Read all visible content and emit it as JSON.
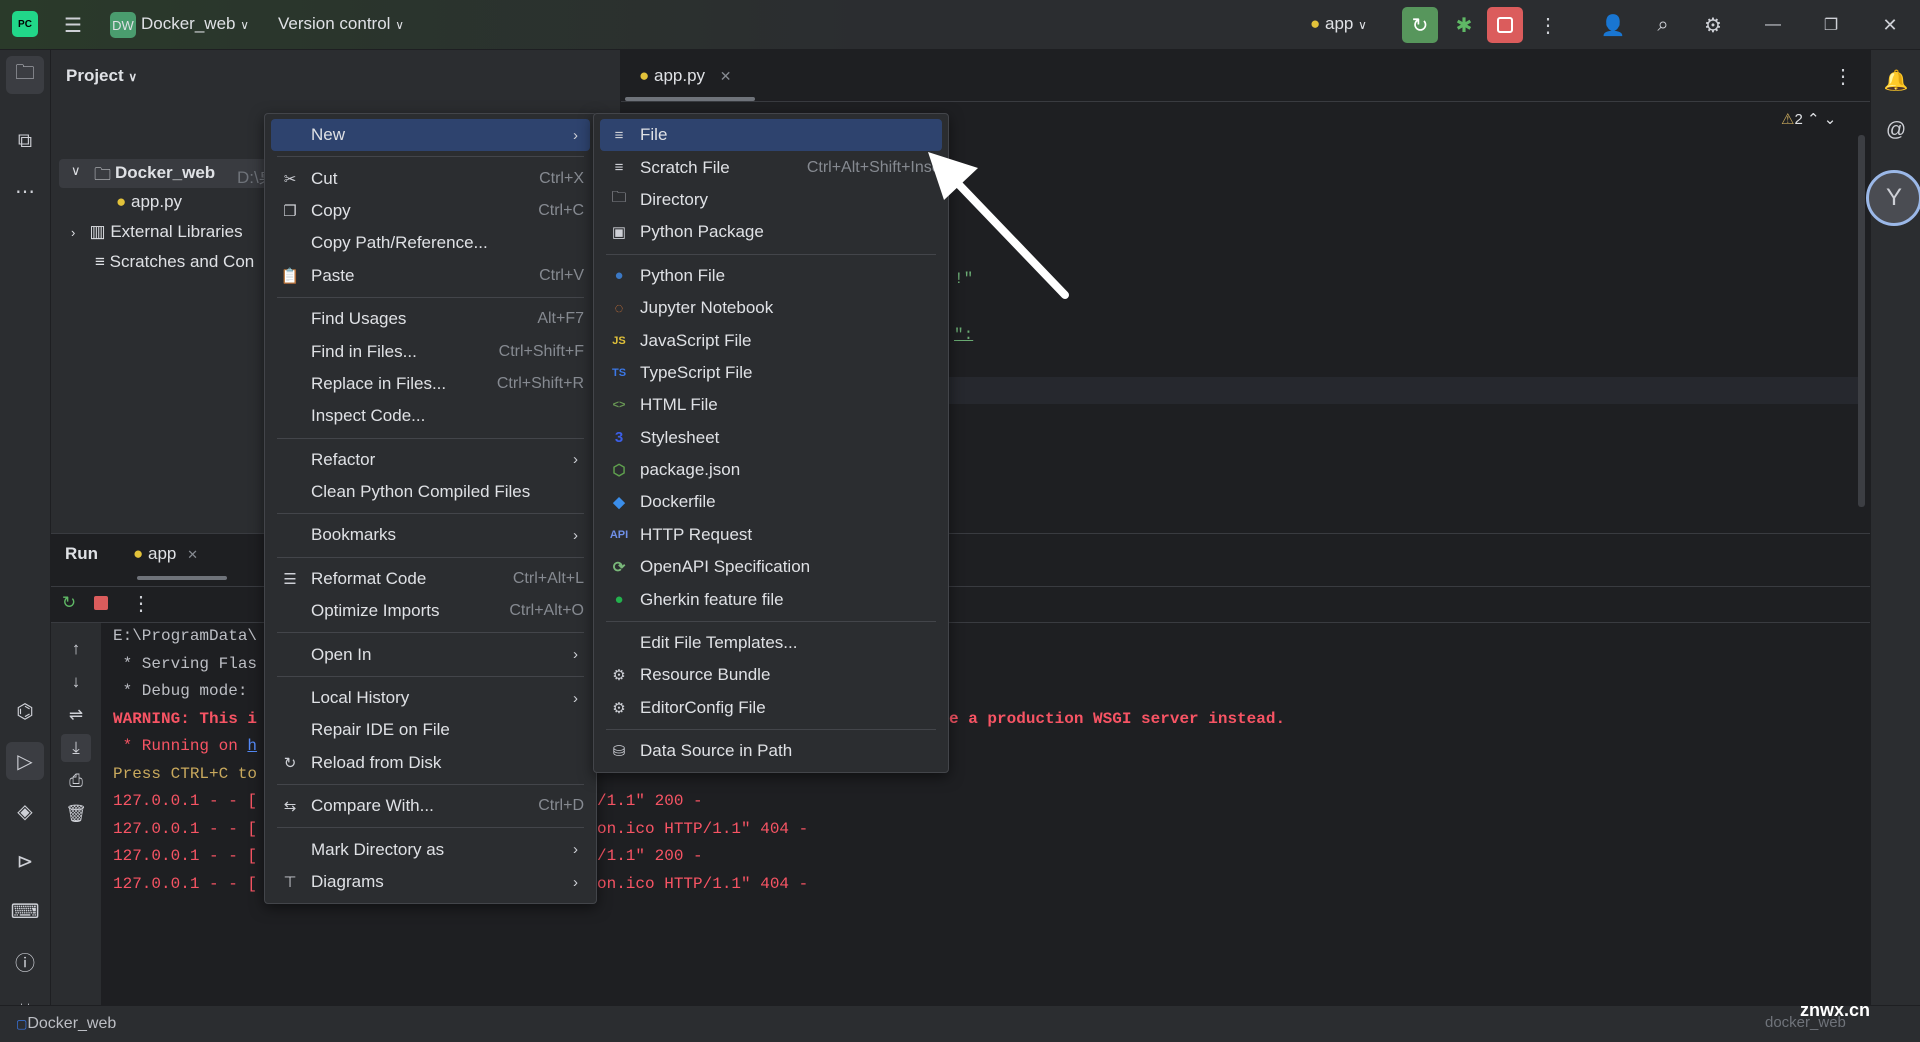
{
  "titlebar": {
    "project_badge": "DW",
    "project_name": "Docker_web",
    "vcs": "Version control",
    "run_config": "app"
  },
  "project_panel": {
    "title": "Project",
    "tree": [
      {
        "label": "Docker_web",
        "path": "D:\\桌"
      },
      {
        "label": "app.py"
      },
      {
        "label": "External Libraries"
      },
      {
        "label": "Scratches and Con"
      }
    ]
  },
  "editor": {
    "tab": "app.py",
    "warnings": "2",
    "fragments": [
      "!\"",
      "\":"
    ]
  },
  "run_panel": {
    "title": "Run",
    "tab": "app",
    "lines": [
      {
        "left": "E:\\ProgramData\\",
        "right": "",
        "color": "#bcbec4"
      },
      {
        "left": " * Serving Flas",
        "right": "",
        "color": "#bcbec4"
      },
      {
        "left": " * Debug mode:",
        "right": "",
        "color": "#bcbec4"
      },
      {
        "left": "WARNING: This i",
        "right": "e a production WSGI server instead.",
        "color": "#f75464",
        "bold": true
      },
      {
        "left": " * Running on ",
        "link": "h",
        "right": "",
        "color": "#f75464"
      },
      {
        "left": "Press CTRL+C to",
        "right": "",
        "color": "#c9a95d"
      },
      {
        "left": "127.0.0.1 - - [",
        "right": "/1.1\" 200 -",
        "color": "#f75464"
      },
      {
        "left": "127.0.0.1 - - [",
        "right": "on.ico HTTP/1.1\" 404 -",
        "color": "#f75464"
      },
      {
        "left": "127.0.0.1 - - [",
        "right": "/1.1\" 200 -",
        "color": "#f75464"
      },
      {
        "left": "127.0.0.1 - - [",
        "right": "on.ico HTTP/1.1\" 404 -",
        "color": "#f75464"
      }
    ]
  },
  "context_menu": [
    {
      "label": "New",
      "sub": true,
      "selected": true
    },
    {
      "sep": true
    },
    {
      "label": "Cut",
      "shortcut": "Ctrl+X",
      "icon": "✂"
    },
    {
      "label": "Copy",
      "shortcut": "Ctrl+C",
      "icon": "❐"
    },
    {
      "label": "Copy Path/Reference..."
    },
    {
      "label": "Paste",
      "shortcut": "Ctrl+V",
      "icon": "📋"
    },
    {
      "sep": true
    },
    {
      "label": "Find Usages",
      "shortcut": "Alt+F7"
    },
    {
      "label": "Find in Files...",
      "shortcut": "Ctrl+Shift+F"
    },
    {
      "label": "Replace in Files...",
      "shortcut": "Ctrl+Shift+R"
    },
    {
      "label": "Inspect Code..."
    },
    {
      "sep": true
    },
    {
      "label": "Refactor",
      "sub": true
    },
    {
      "label": "Clean Python Compiled Files"
    },
    {
      "sep": true
    },
    {
      "label": "Bookmarks",
      "sub": true
    },
    {
      "sep": true
    },
    {
      "label": "Reformat Code",
      "shortcut": "Ctrl+Alt+L",
      "icon": "☰"
    },
    {
      "label": "Optimize Imports",
      "shortcut": "Ctrl+Alt+O"
    },
    {
      "sep": true
    },
    {
      "label": "Open In",
      "sub": true
    },
    {
      "sep": true
    },
    {
      "label": "Local History",
      "sub": true
    },
    {
      "label": "Repair IDE on File"
    },
    {
      "label": "Reload from Disk",
      "icon": "↻"
    },
    {
      "sep": true
    },
    {
      "label": "Compare With...",
      "shortcut": "Ctrl+D",
      "icon": "⇆"
    },
    {
      "sep": true
    },
    {
      "label": "Mark Directory as",
      "sub": true
    },
    {
      "label": "Diagrams",
      "sub": true,
      "icon": "⊤"
    }
  ],
  "new_submenu": [
    {
      "label": "File",
      "icon": "≡",
      "selected": true
    },
    {
      "label": "Scratch File",
      "shortcut": "Ctrl+Alt+Shift+Inser",
      "icon": "≡"
    },
    {
      "label": "Directory",
      "icon": "🗀"
    },
    {
      "label": "Python Package",
      "icon": "▣"
    },
    {
      "sep": true
    },
    {
      "label": "Python File",
      "icon": "●",
      "color": "#3b78c4"
    },
    {
      "label": "Jupyter Notebook",
      "icon": "◌",
      "color": "#e07b39"
    },
    {
      "label": "JavaScript File",
      "icon": "JS",
      "color": "#e2c23a"
    },
    {
      "label": "TypeScript File",
      "icon": "TS",
      "color": "#3b78e7"
    },
    {
      "label": "HTML File",
      "icon": "<>",
      "color": "#6a9955"
    },
    {
      "label": "Stylesheet",
      "icon": "3",
      "color": "#3b5ee7"
    },
    {
      "label": "package.json",
      "icon": "⬡",
      "color": "#5fa04e"
    },
    {
      "label": "Dockerfile",
      "icon": "◆",
      "color": "#3b8eea"
    },
    {
      "label": "HTTP Request",
      "icon": "API",
      "color": "#6f8fe8"
    },
    {
      "label": "OpenAPI Specification",
      "icon": "⟳",
      "color": "#7ab87a"
    },
    {
      "label": "Gherkin feature file",
      "icon": "●",
      "color": "#23b14d"
    },
    {
      "sep": true
    },
    {
      "label": "Edit File Templates..."
    },
    {
      "label": "Resource Bundle",
      "icon": "⚙"
    },
    {
      "label": "EditorConfig File",
      "icon": "⚙"
    },
    {
      "sep": true
    },
    {
      "label": "Data Source in Path",
      "icon": "⛁"
    }
  ],
  "statusbar": {
    "project": "Docker_web",
    "watermark": "znwx.cn",
    "watermark_sub": "docker_web"
  },
  "colors": {
    "accent": "#2e436e",
    "run_green": "#57965c",
    "stop_red": "#db5c5c"
  }
}
